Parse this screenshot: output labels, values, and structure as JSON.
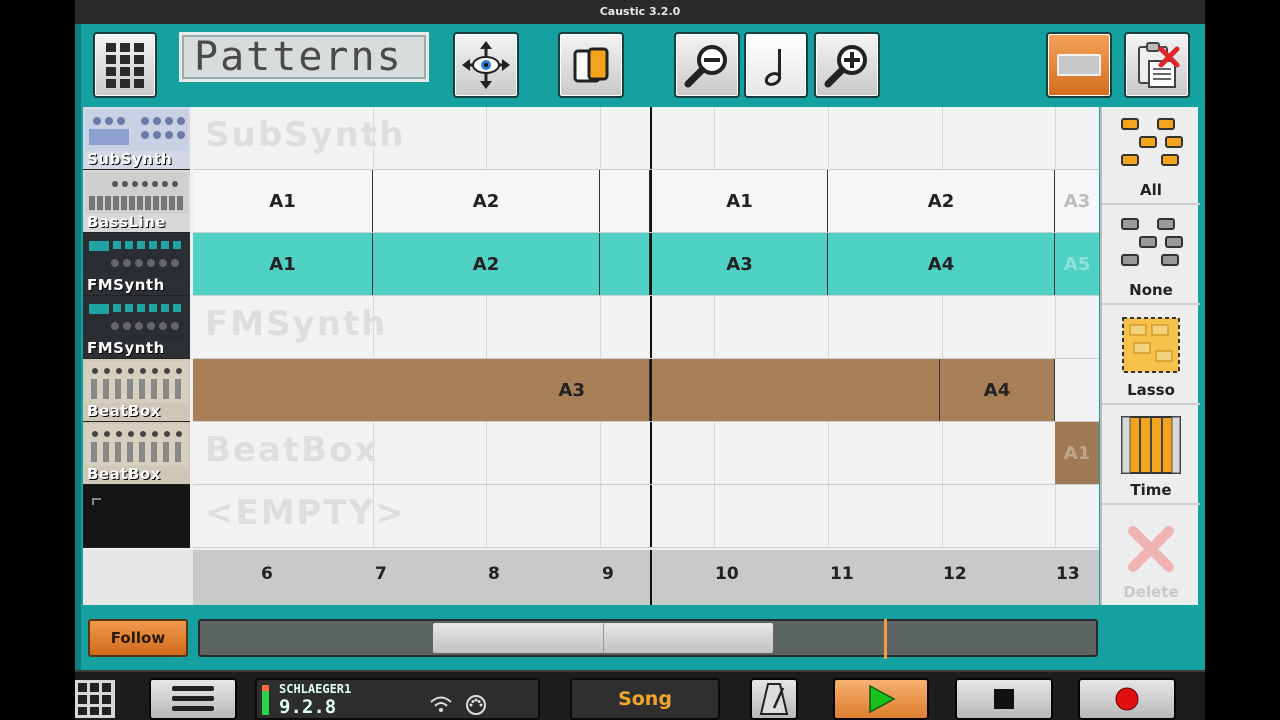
{
  "window": {
    "title": "Caustic 3.2.0"
  },
  "toolbar": {
    "view_label": "Patterns",
    "buttons": [
      "grid-menu",
      "move",
      "copy",
      "zoom-out",
      "note",
      "zoom-in",
      "orange-toggle",
      "clipboard-delete"
    ]
  },
  "tracks": [
    {
      "name": "SubSynth",
      "ghost": "SubSynth",
      "type": "empty"
    },
    {
      "name": "BassLine",
      "ghost": "",
      "type": "white"
    },
    {
      "name": "FMSynth",
      "ghost": "",
      "type": "teal"
    },
    {
      "name": "FMSynth",
      "ghost": "FMSynth",
      "type": "empty"
    },
    {
      "name": "BeatBox",
      "ghost": "",
      "type": "brown"
    },
    {
      "name": "BeatBox",
      "ghost": "BeatBox",
      "type": "brown-partial"
    },
    {
      "name": "",
      "ghost": "<EMPTY>",
      "type": "empty"
    }
  ],
  "patterns": {
    "bassline": [
      "A1",
      "A2",
      "A1",
      "A2",
      "A3"
    ],
    "fmsynth": [
      "A1",
      "A2",
      "A3",
      "A4",
      "A5"
    ],
    "beatbox": [
      "A3",
      "A4"
    ],
    "beatbox2": [
      "A1"
    ]
  },
  "ruler": {
    "ticks": [
      "6",
      "7",
      "8",
      "9",
      "10",
      "11",
      "12",
      "13"
    ]
  },
  "side_panel": {
    "all": "All",
    "none": "None",
    "lasso": "Lasso",
    "time": "Time",
    "delete": "Delete"
  },
  "transport": {
    "follow": "Follow",
    "device_name": "SCHLAEGER1",
    "version": "9.2.8",
    "mode": "Song"
  },
  "colors": {
    "app_bg": "#16a1a1",
    "teal_pattern": "#4fd1c6",
    "brown_pattern": "#a97f58",
    "accent_orange": "#e07a28",
    "song_text": "#f0a52d",
    "play_green": "#19c21a",
    "record_red": "#e01010"
  }
}
